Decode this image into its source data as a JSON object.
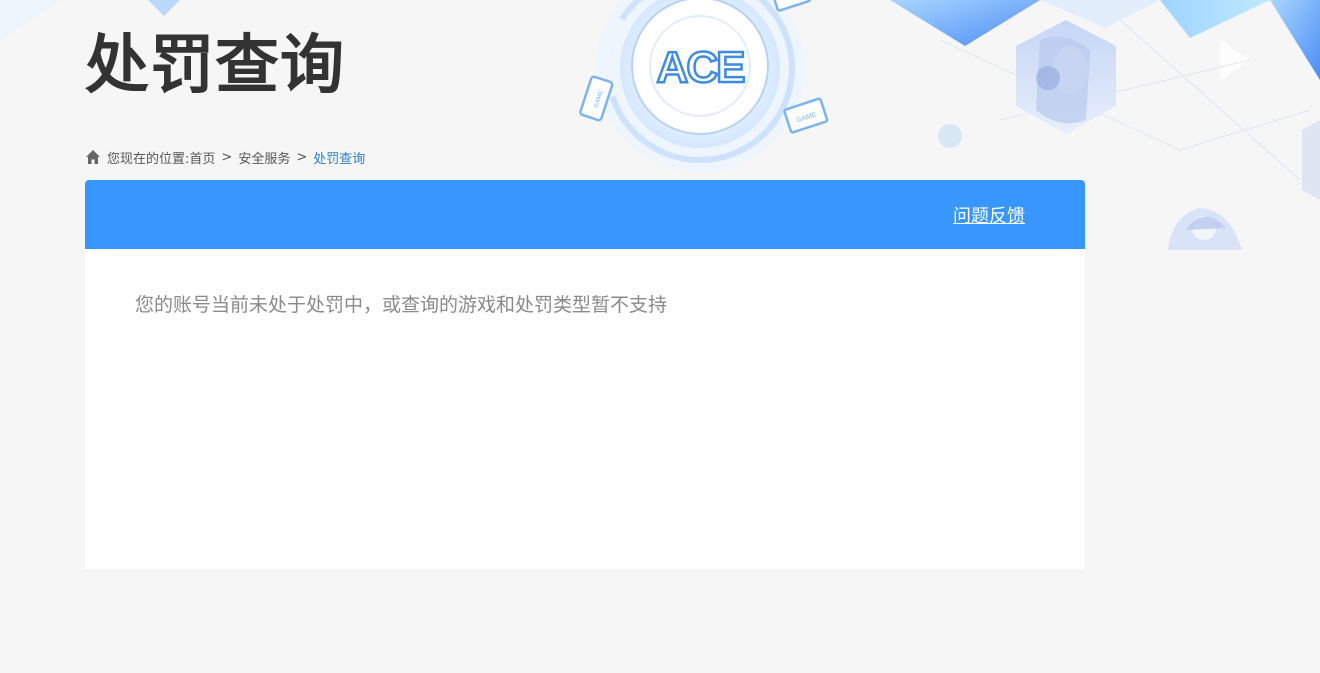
{
  "header": {
    "title": "处罚查询",
    "logo_text": "ACE",
    "badge_text": "GAME"
  },
  "breadcrumb": {
    "prefix": "您现在的位置:",
    "items": [
      "首页",
      "安全服务"
    ],
    "separator": ">",
    "current": "处罚查询"
  },
  "panel": {
    "feedback_label": "问题反馈",
    "message": "您的账号当前未处于处罚中，或查询的游戏和处罚类型暂不支持"
  },
  "colors": {
    "accent": "#3897fd",
    "title": "#333333",
    "link_current": "#2a7fc9",
    "message": "#8a8a8a"
  }
}
